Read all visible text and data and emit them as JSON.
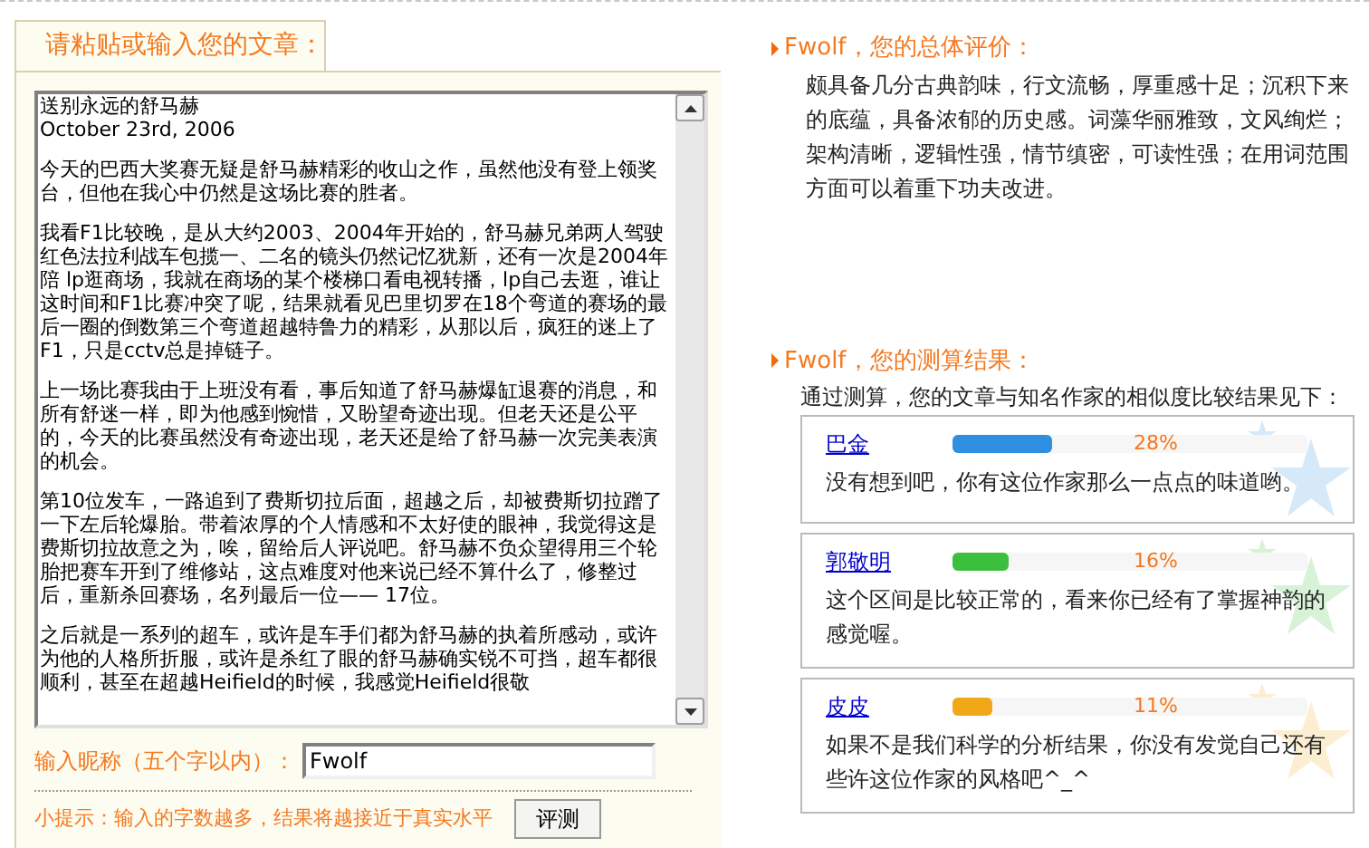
{
  "input_panel": {
    "title": "请粘贴或输入您的文章：",
    "article": [
      "送别永远的舒马赫",
      "October 23rd, 2006",
      "今天的巴西大奖赛无疑是舒马赫精彩的收山之作，虽然他没有登上领奖台，但他在我心中仍然是这场比赛的胜者。",
      "我看F1比较晚，是从大约2003、2004年开始的，舒马赫兄弟两人驾驶红色法拉利战车包揽一、二名的镜头仍然记忆犹新，还有一次是2004年陪 lp逛商场，我就在商场的某个楼梯口看电视转播，lp自己去逛，谁让这时间和F1比赛冲突了呢，结果就看见巴里切罗在18个弯道的赛场的最后一圈的倒数第三个弯道超越特鲁力的精彩，从那以后，疯狂的迷上了F1，只是cctv总是掉链子。",
      "上一场比赛我由于上班没有看，事后知道了舒马赫爆缸退赛的消息，和所有舒迷一样，即为他感到惋惜，又盼望奇迹出现。但老天还是公平的，今天的比赛虽然没有奇迹出现，老天还是给了舒马赫一次完美表演的机会。",
      "第10位发车，一路追到了费斯切拉后面，超越之后，却被费斯切拉蹭了一下左后轮爆胎。带着浓厚的个人情感和不太好使的眼神，我觉得这是费斯切拉故意之为，唉，留给后人评说吧。舒马赫不负众望得用三个轮胎把赛车开到了维修站，这点难度对他来说已经不算什么了，修整过后，重新杀回赛场，名列最后一位—— 17位。",
      "之后就是一系列的超车，或许是车手们都为舒马赫的执着所感动，或许为他的人格所折服，或许是杀红了眼的舒马赫确实锐不可挡，超车都很顺利，甚至在超越Heifield的时候，我感觉Heifield很敬"
    ],
    "nickname_label": "输入昵称（五个字以内）：",
    "nickname_value": "Fwolf",
    "hint": "小提示：输入的字数越多，结果将越接近于真实水平",
    "submit_button": "评测"
  },
  "overall": {
    "title": "Fwolf，您的总体评价：",
    "text": "颇具备几分古典韵味，行文流畅，厚重感十足；沉积下来的底蕴，具备浓郁的历史感。词藻华丽雅致，文风绚烂；架构清晰，逻辑性强，情节缜密，可读性强；在用词范围方面可以着重下功夫改进。"
  },
  "results": {
    "title": "Fwolf，您的测算结果：",
    "intro": "通过测算，您的文章与知名作家的相似度比较结果见下：",
    "authors": [
      {
        "name": "巴金",
        "level": 0.28,
        "percent": "28%",
        "color": "#2f8fe0",
        "comment": "没有想到吧，你有这位作家那么一点点的味道哟。"
      },
      {
        "name": "郭敬明",
        "level": 0.16,
        "percent": "16%",
        "color": "#3cbf3c",
        "comment": "这个区间是比较正常的，看来你已经有了掌握神韵的感觉喔。"
      },
      {
        "name": "皮皮",
        "level": 0.11,
        "percent": "11%",
        "color": "#f0a818",
        "comment": "如果不是我们科学的分析结果，你没有发觉自己还有些许这位作家的风格吧^_^"
      }
    ]
  }
}
